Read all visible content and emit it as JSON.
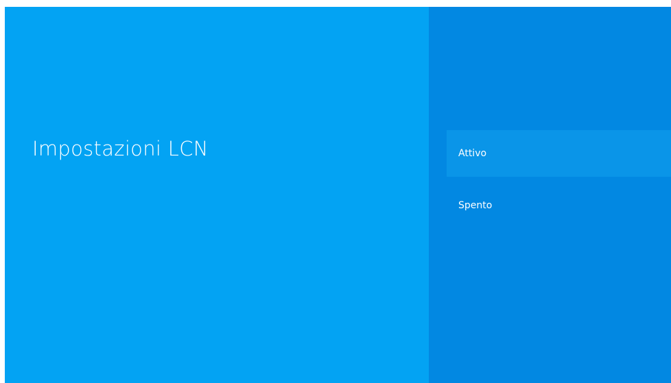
{
  "screen": {
    "title": "Impostazioni LCN",
    "options": [
      {
        "label": "Attivo",
        "selected": true
      },
      {
        "label": "Spento",
        "selected": false
      }
    ]
  },
  "colors": {
    "left_panel": "#03A3F3",
    "right_panel": "#0288E2",
    "selected_highlight": "#0A95E8",
    "text": "#FFFFFF"
  }
}
